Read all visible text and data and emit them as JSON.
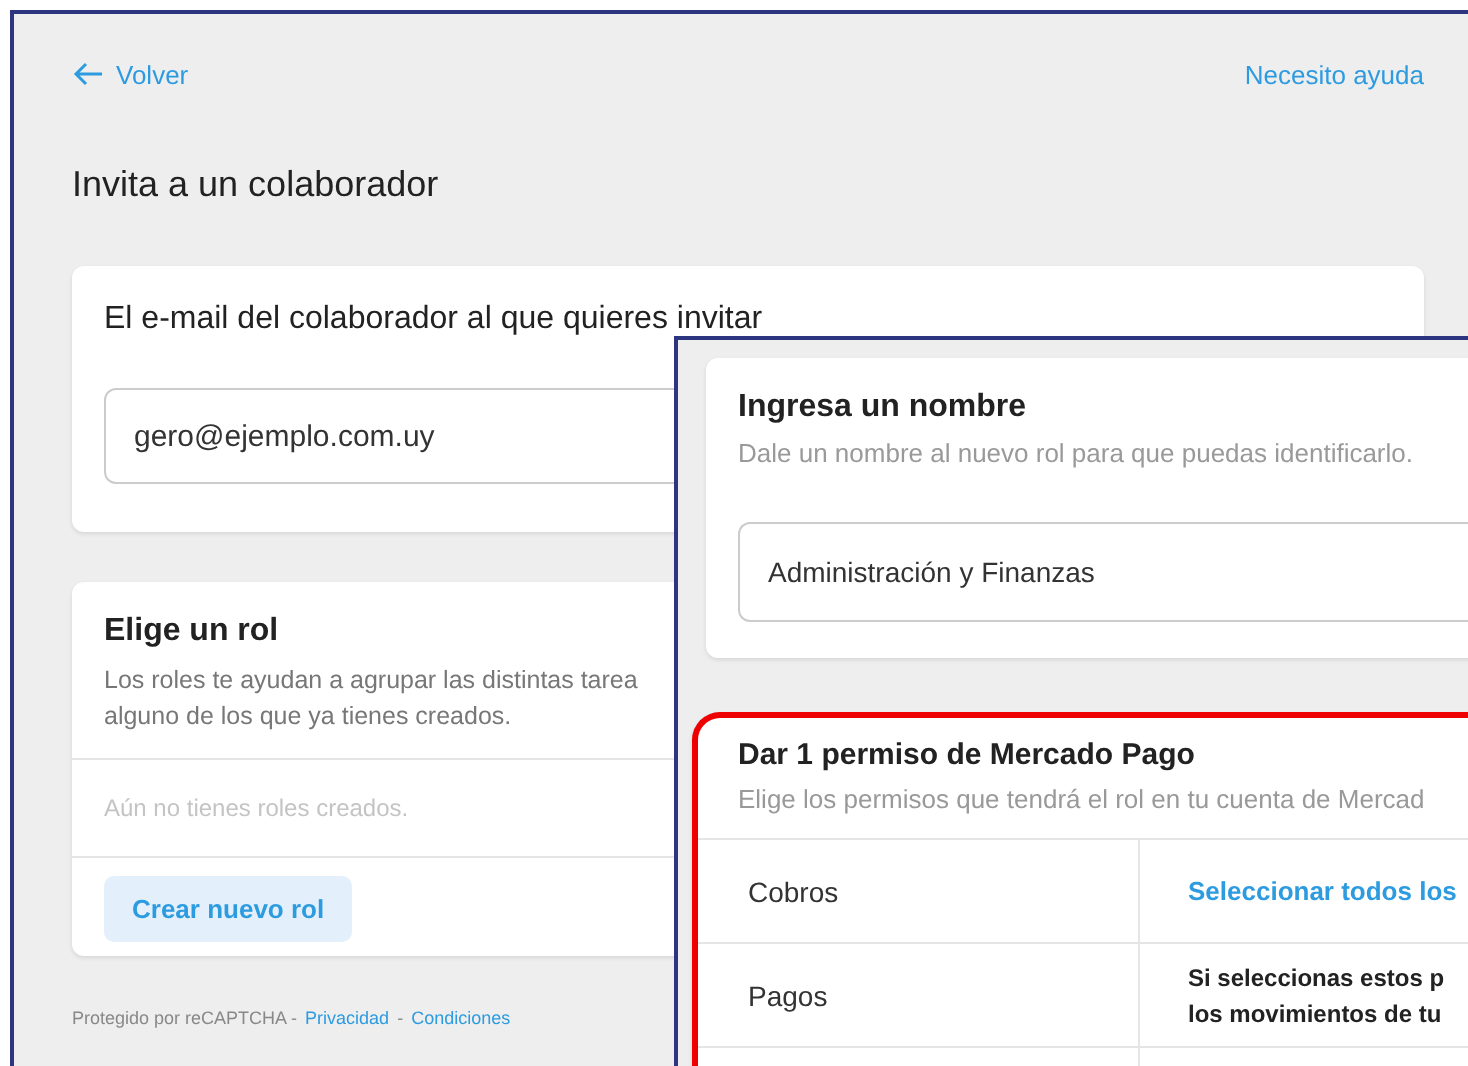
{
  "back_link": "Volver",
  "help_link": "Necesito ayuda",
  "title": "Invita a un colaborador",
  "email_card": {
    "heading": "El e-mail del colaborador al que quieres invitar",
    "value": "gero@ejemplo.com.uy"
  },
  "role_card": {
    "heading": "Elige un rol",
    "description_lines": [
      "Los roles te ayudan a agrupar las distintas tarea",
      "alguno de los que ya tienes creados."
    ],
    "empty_message": "Aún no tienes roles creados.",
    "button": "Crear nuevo rol"
  },
  "footer": [
    {
      "kind": "text",
      "text": "Protegido por reCAPTCHA -"
    },
    {
      "kind": "link",
      "text": "Privacidad"
    },
    {
      "kind": "text",
      "text": "-"
    },
    {
      "kind": "link",
      "text": "Condiciones"
    }
  ],
  "role_form": {
    "name_card": {
      "heading": "Ingresa un nombre",
      "description": "Dale un nombre al nuevo rol para que puedas identificarlo.",
      "value": "Administración y Finanzas"
    },
    "permissions_card": {
      "heading": "Dar 1 permiso de Mercado Pago",
      "description": "Elige los permisos que tendrá el rol en tu cuenta de Mercad",
      "rows": [
        {
          "label": "Cobros",
          "kind": "link",
          "lines": [
            "Seleccionar todos los"
          ]
        },
        {
          "label": "Pagos",
          "kind": "note",
          "lines": [
            "Si seleccionas estos p",
            "los movimientos de tu"
          ]
        }
      ]
    }
  }
}
